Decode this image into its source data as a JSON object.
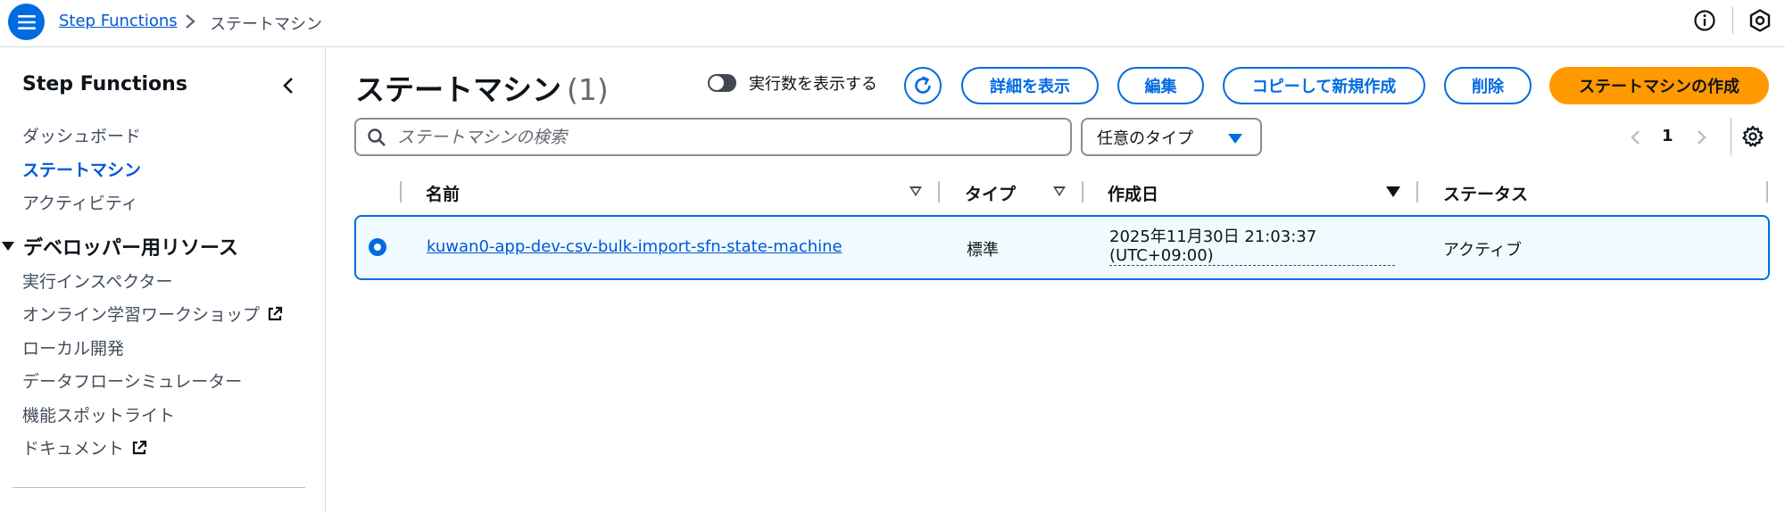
{
  "breadcrumb": {
    "root": "Step Functions",
    "current": "ステートマシン"
  },
  "sidebar": {
    "title": "Step Functions",
    "items": [
      {
        "label": "ダッシュボード"
      },
      {
        "label": "ステートマシン"
      },
      {
        "label": "アクティビティ"
      }
    ],
    "section": {
      "title": "デベロッパー用リソース",
      "items": [
        {
          "label": "実行インスペクター"
        },
        {
          "label": "オンライン学習ワークショップ"
        },
        {
          "label": "ローカル開発"
        },
        {
          "label": "データフローシミュレーター"
        },
        {
          "label": "機能スポットライト"
        },
        {
          "label": "ドキュメント"
        }
      ]
    }
  },
  "header": {
    "title": "ステートマシン",
    "count": "(1)",
    "toggle_label": "実行数を表示する",
    "buttons": {
      "details": "詳細を表示",
      "edit": "編集",
      "copy": "コピーして新規作成",
      "delete": "削除",
      "create": "ステートマシンの作成"
    }
  },
  "filter": {
    "search_placeholder": "ステートマシンの検索",
    "type_select": "任意のタイプ",
    "page": "1"
  },
  "table": {
    "columns": {
      "name": "名前",
      "type": "タイプ",
      "created": "作成日",
      "status": "ステータス"
    },
    "rows": [
      {
        "name": "kuwan0-app-dev-csv-bulk-import-sfn-state-machine",
        "type": "標準",
        "created_line1": "2025年11月30日 21:03:37",
        "created_line2": "(UTC+09:00)",
        "status": "アクティブ"
      }
    ]
  },
  "colors": {
    "accent": "#006ce0",
    "link": "#0057d8",
    "primary_button": "#ff9900",
    "selected_row_bg": "#f0fbff"
  },
  "icons": [
    "menu-icon",
    "chevron-right-icon",
    "info-icon",
    "settings-icon",
    "chevron-left-icon",
    "external-link-icon",
    "refresh-icon",
    "search-icon",
    "caret-down-icon",
    "gear-icon"
  ]
}
